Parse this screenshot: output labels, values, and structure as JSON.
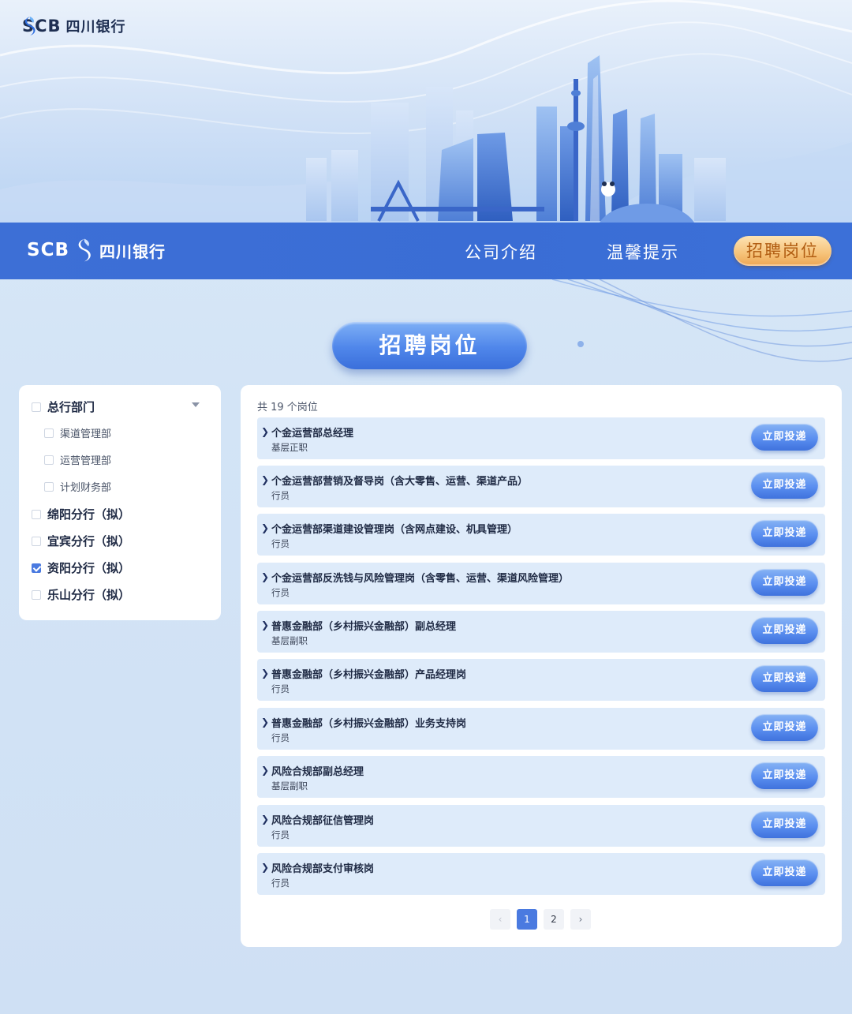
{
  "brand": {
    "scb": "SCB",
    "name": "四川银行"
  },
  "nav": {
    "company": "公司介绍",
    "tips": "温馨提示",
    "jobs": "招聘岗位"
  },
  "page_title": "招聘岗位",
  "filters": {
    "groups": [
      {
        "label": "总行部门",
        "checked": false,
        "expandable": true,
        "children": [
          {
            "label": "渠道管理部",
            "checked": false
          },
          {
            "label": "运营管理部",
            "checked": false
          },
          {
            "label": "计划财务部",
            "checked": false
          }
        ]
      },
      {
        "label": "绵阳分行（拟）",
        "checked": false
      },
      {
        "label": "宜宾分行（拟）",
        "checked": false
      },
      {
        "label": "资阳分行（拟）",
        "checked": true
      },
      {
        "label": "乐山分行（拟）",
        "checked": false
      }
    ]
  },
  "job_list": {
    "count_text": "共 19 个岗位",
    "apply_label": "立即投递",
    "items": [
      {
        "title": "个金运营部总经理",
        "level": "基层正职"
      },
      {
        "title": "个金运营部营销及督导岗（含大零售、运营、渠道产品）",
        "level": "行员"
      },
      {
        "title": "个金运营部渠道建设管理岗（含网点建设、机具管理）",
        "level": "行员"
      },
      {
        "title": "个金运营部反洗钱与风险管理岗（含零售、运营、渠道风险管理）",
        "level": "行员"
      },
      {
        "title": "普惠金融部（乡村振兴金融部）副总经理",
        "level": "基层副职"
      },
      {
        "title": "普惠金融部（乡村振兴金融部）产品经理岗",
        "level": "行员"
      },
      {
        "title": "普惠金融部（乡村振兴金融部）业务支持岗",
        "level": "行员"
      },
      {
        "title": "风险合规部副总经理",
        "level": "基层副职"
      },
      {
        "title": "风险合规部征信管理岗",
        "level": "行员"
      },
      {
        "title": "风险合规部支付审核岗",
        "level": "行员"
      }
    ]
  },
  "pagination": {
    "prev": "‹",
    "pages": [
      "1",
      "2"
    ],
    "current": "1",
    "next": "›"
  },
  "colors": {
    "primary": "#3d6fd6",
    "accent_gold": "#f6c278",
    "row_bg": "#deebfa"
  }
}
